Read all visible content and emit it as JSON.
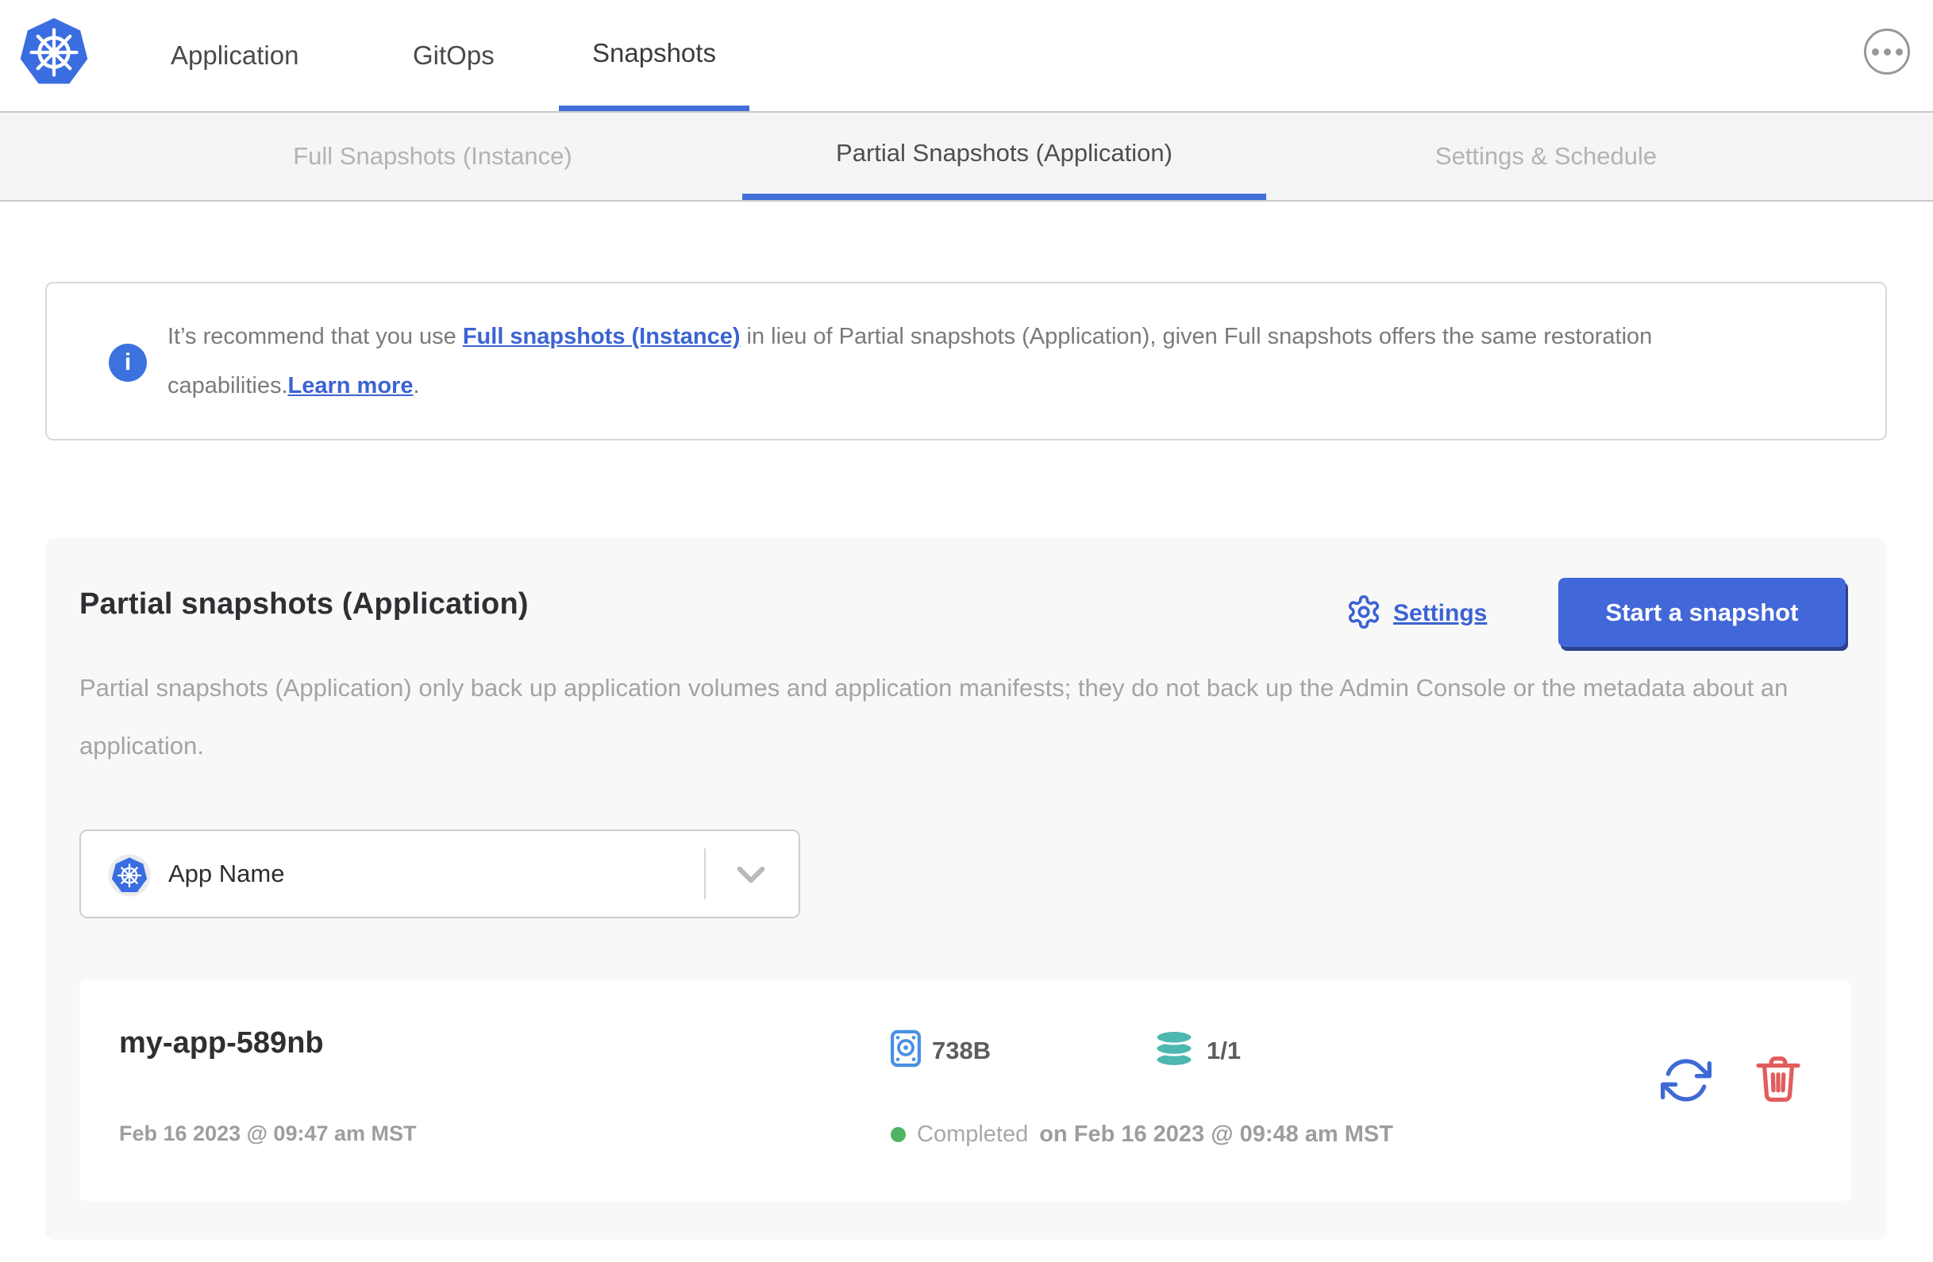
{
  "nav": {
    "logo": "kubernetes-logo",
    "items": [
      {
        "label": "Application"
      },
      {
        "label": "GitOps"
      },
      {
        "label": "Snapshots",
        "active": true
      }
    ]
  },
  "subtabs": {
    "items": [
      {
        "label": "Full Snapshots (Instance)"
      },
      {
        "label": "Partial Snapshots (Application)",
        "active": true
      },
      {
        "label": "Settings & Schedule"
      }
    ]
  },
  "banner": {
    "text1": "It’s recommend that you use ",
    "link_full_snapshots": "Full snapshots (Instance)",
    "text2": " in lieu of Partial snapshots (Application), given Full snapshots offers the same restoration capabilities.",
    "link_learn_more": "Learn more",
    "text3": "."
  },
  "panel": {
    "title": "Partial snapshots (Application)",
    "settings_label": "Settings",
    "start_button_label": "Start a snapshot",
    "description": "Partial snapshots (Application) only back up application volumes and application manifests; they do not back up the Admin Console or the metadata about an application.",
    "app_selector": {
      "selected": "App Name"
    }
  },
  "snapshot": {
    "name": "my-app-589nb",
    "created_at": "Feb 16 2023 @ 09:47 am MST",
    "size": "738B",
    "volume_count": "1/1",
    "status": "Completed",
    "finished_at": "on Feb 16 2023 @ 09:48 am MST"
  },
  "colors": {
    "accent_blue": "#4270d8",
    "link_blue": "#3b63d3",
    "button_blue": "#4267d8",
    "k8s_blue": "#3a6de0",
    "disk_blue": "#4a90e2",
    "teal": "#4cb8b0",
    "green": "#4db564",
    "red": "#e25c5c"
  }
}
